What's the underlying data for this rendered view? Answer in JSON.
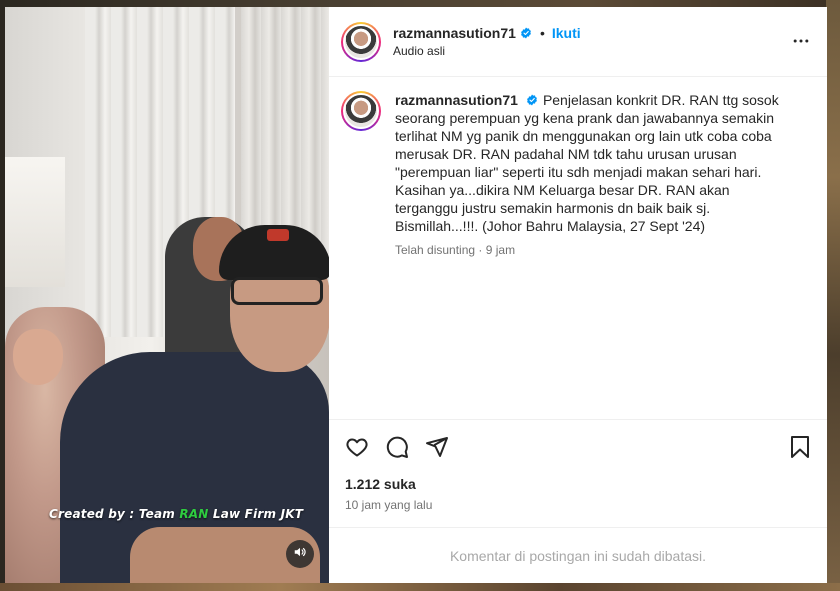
{
  "post": {
    "username": "razmannasution71",
    "follow_label": "Ikuti",
    "dot": "•",
    "audio_label": "Audio asli",
    "caption": "Penjelasan konkrit DR. RAN ttg sosok seorang perempuan yg kena prank dan jawabannya semakin terlihat NM yg panik dn menggunakan org lain utk coba coba merusak DR. RAN padahal NM tdk tahu urusan urusan \"perempuan liar\" seperti itu sdh menjadi makan sehari hari. Kasihan ya...dikira NM Keluarga besar DR. RAN akan terganggu justru semakin harmonis dn baik baik sj. Bismillah...!!!. (Johor Bahru Malaysia, 27 Sept '24)",
    "caption_meta": "Telah disunting · 9 jam",
    "likes": "1.212 suka",
    "timestamp": "10 jam yang lalu",
    "comments_disabled": "Komentar di postingan ini sudah dibatasi."
  },
  "media": {
    "watermark_prefix": "Created by : Team ",
    "watermark_highlight": "RAN",
    "watermark_suffix": " Law Firm JKT"
  },
  "icons": {
    "verified": "verified-badge-icon",
    "more": "more-options-icon",
    "like": "heart-icon",
    "comment": "comment-icon",
    "share": "send-icon",
    "save": "bookmark-icon",
    "sound": "speaker-icon"
  },
  "colors": {
    "accent": "#0095f6",
    "watermark_highlight": "#2ecc40",
    "text": "#262626",
    "muted": "#737373"
  }
}
